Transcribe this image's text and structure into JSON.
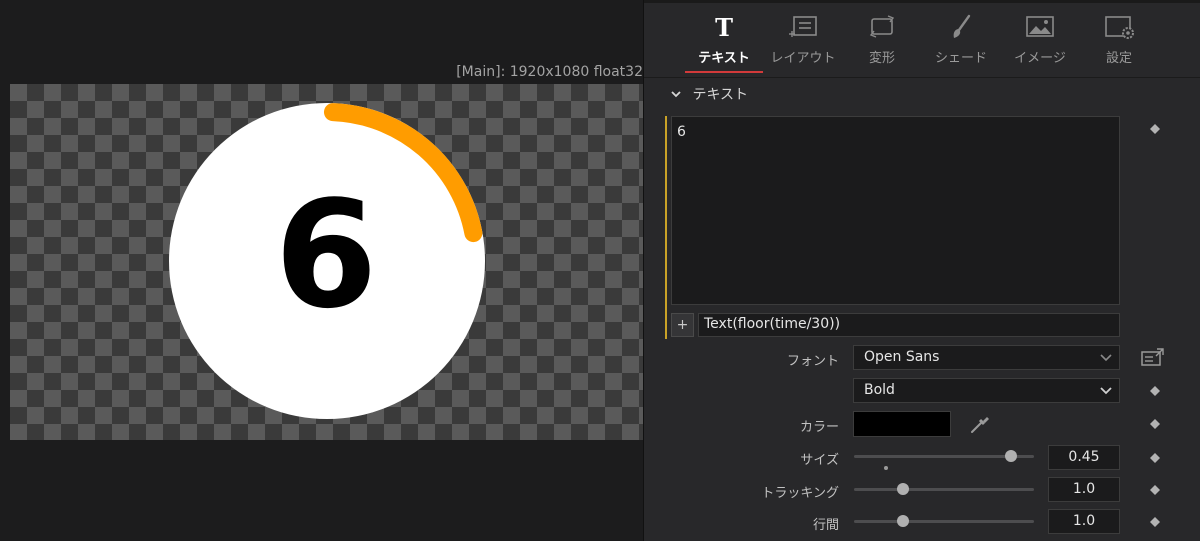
{
  "viewer": {
    "info": "[Main]: 1920x1080 float32",
    "countdown_value": "6",
    "ring_color": "#ff9c00",
    "ring_progress": 0.22
  },
  "tabs": [
    {
      "label": "テキスト",
      "icon": "text-tool-icon",
      "active": true
    },
    {
      "label": "レイアウト",
      "icon": "layout-icon",
      "active": false
    },
    {
      "label": "変形",
      "icon": "transform-icon",
      "active": false
    },
    {
      "label": "シェード",
      "icon": "shading-brush-icon",
      "active": false
    },
    {
      "label": "イメージ",
      "icon": "image-icon",
      "active": false
    },
    {
      "label": "設定",
      "icon": "settings-gear-icon",
      "active": false
    }
  ],
  "section": {
    "title": "テキスト"
  },
  "text_input": {
    "value": "6"
  },
  "expression": {
    "plus": "+",
    "value": "Text(floor(time/30))"
  },
  "font": {
    "label": "フォント",
    "family": "Open Sans",
    "style": "Bold"
  },
  "color": {
    "label": "カラー",
    "value": "#000000"
  },
  "size": {
    "label": "サイズ",
    "value": "0.45",
    "slider_fraction": 0.87
  },
  "tracking": {
    "label": "トラッキング",
    "value": "1.0",
    "slider_fraction": 0.27
  },
  "line_spacing": {
    "label": "行間",
    "value": "1.0",
    "slider_fraction": 0.27
  }
}
